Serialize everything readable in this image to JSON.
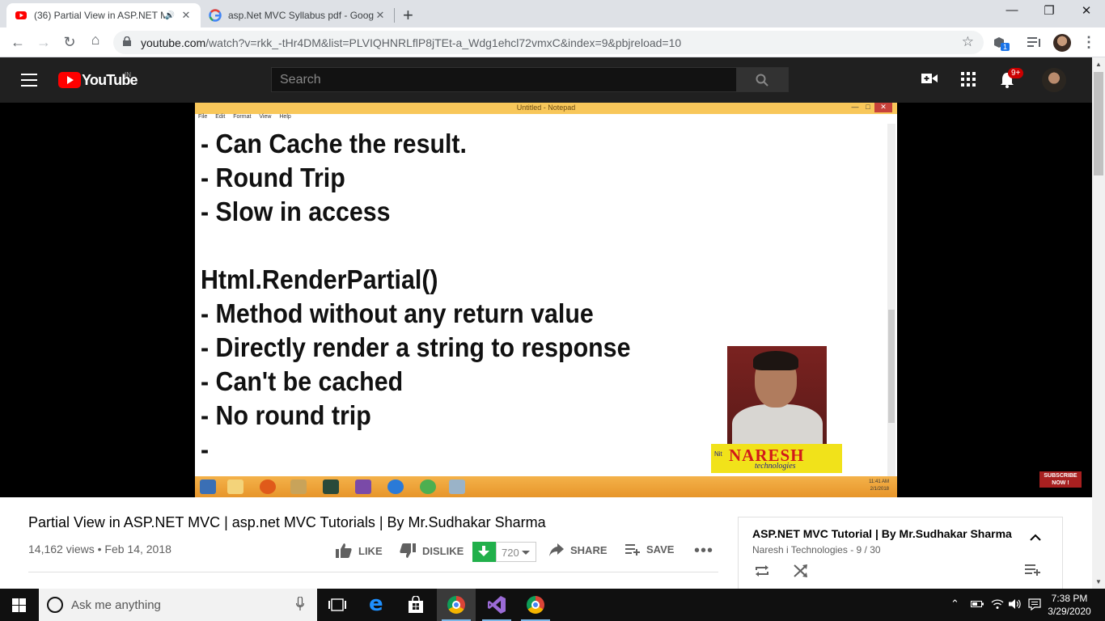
{
  "browser": {
    "tabs": [
      {
        "title": "(36) Partial View in ASP.NET M",
        "active": true,
        "favicon": "youtube-favicon"
      },
      {
        "title": "asp.Net MVC Syllabus pdf - Goog",
        "active": false,
        "favicon": "google-favicon"
      }
    ],
    "url_host": "youtube.com",
    "url_path": "/watch?v=rkk_-tHr4DM&list=PLVIQHNRLflP8jTEt-a_Wdg1ehcl72vmxC&index=9&pbjreload=10",
    "extension_badge": "1"
  },
  "youtube": {
    "logo_text": "YouTube",
    "region": "IN",
    "search_placeholder": "Search",
    "notification_count": "9+"
  },
  "video_frame": {
    "notepad_title": "Untitled - Notepad",
    "menu": [
      "File",
      "Edit",
      "Format",
      "View",
      "Help"
    ],
    "lines": [
      "- Can Cache the result.",
      "- Round Trip",
      "- Slow in access",
      "",
      "Html.RenderPartial()",
      "- Method without any return value",
      "- Directly render a string to response",
      "- Can't be cached",
      "- No round trip",
      "-"
    ],
    "brand_name": "NARESH",
    "brand_sub": "technologies",
    "inner_clock_time": "11:41 AM",
    "inner_clock_date": "2/1/2018",
    "subscribe_line1": "SUBSCRIBE",
    "subscribe_line2": "NOW !"
  },
  "video": {
    "title": "Partial View in ASP.NET MVC | asp.net MVC Tutorials | By Mr.Sudhakar Sharma",
    "views": "14,162 views",
    "date": "Feb 14, 2018",
    "like_label": "LIKE",
    "dislike_label": "DISLIKE",
    "download_count": "720",
    "share_label": "SHARE",
    "save_label": "SAVE"
  },
  "playlist": {
    "title": "ASP.NET MVC Tutorial | By Mr.Sudhakar Sharma",
    "channel": "Naresh i Technologies",
    "position": "9 / 30"
  },
  "taskbar": {
    "search_placeholder": "Ask me anything",
    "time": "7:38 PM",
    "date": "3/29/2020"
  }
}
